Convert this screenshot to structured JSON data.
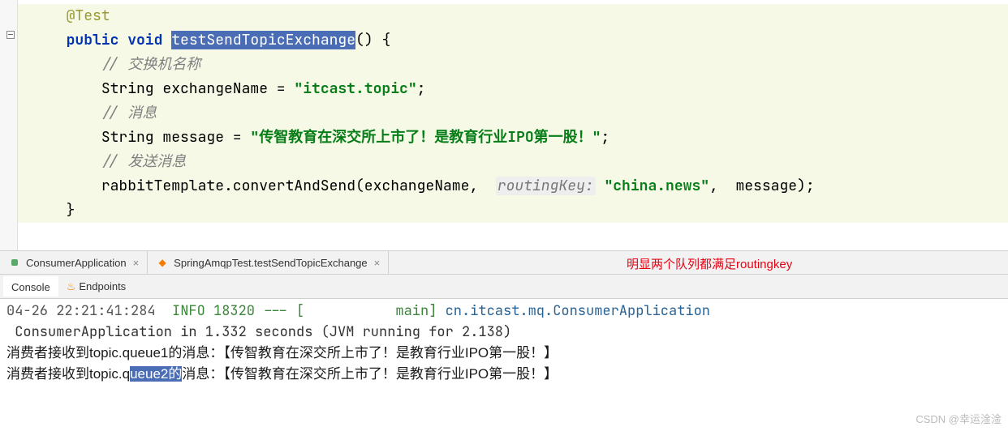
{
  "code": {
    "annotation": "@Test",
    "modifiers": "public void",
    "method_name": "testSendTopicExchange",
    "after_name": "() {",
    "comment1": "// 交换机名称",
    "line3_a": "String exchangeName = ",
    "line3_str": "\"itcast.topic\"",
    "line3_b": ";",
    "comment2": "// 消息",
    "line5_a": "String message = ",
    "line5_str": "\"传智教育在深交所上市了！是教育行业IPO第一股！\"",
    "line5_b": ";",
    "comment3": "// 发送消息",
    "line7_a": "rabbitTemplate.convertAndSend(exchangeName,  ",
    "line7_hint": "routingKey:",
    "line7_sp": " ",
    "line7_str_a": "\"ch",
    "line7_str_caret": "i",
    "line7_str_b": "na.news\"",
    "line7_c": ",  message);",
    "close": "}"
  },
  "tabs": {
    "tab1": "ConsumerApplication",
    "tab2": "SpringAmqpTest.testSendTopicExchange",
    "close": "×"
  },
  "annotation_overlay": "明显两个队列都满足routingkey",
  "tools": {
    "console": "Console",
    "endpoints": "Endpoints"
  },
  "console": {
    "l1_time": "04-26 22:21:41:284",
    "l1_level": "  INFO 18320 --- [           main] ",
    "l1_pkg": "cn.itcast.mq.ConsumerApplication",
    "l2": " ConsumerApplication in 1.332 seconds (JVM running for 2.138)",
    "l3_a": "消费者接收到topic.queue1的消息：【传智教育在深交所上市了！是教育行业IPO第一股！】",
    "l4_pre": "消费者接收到topic.q",
    "l4_hl": "ueue2的",
    "l4_post": "消息：【传智教育在深交所上市了！是教育行业IPO第一股！】"
  },
  "watermark": "CSDN @幸运淦淦"
}
